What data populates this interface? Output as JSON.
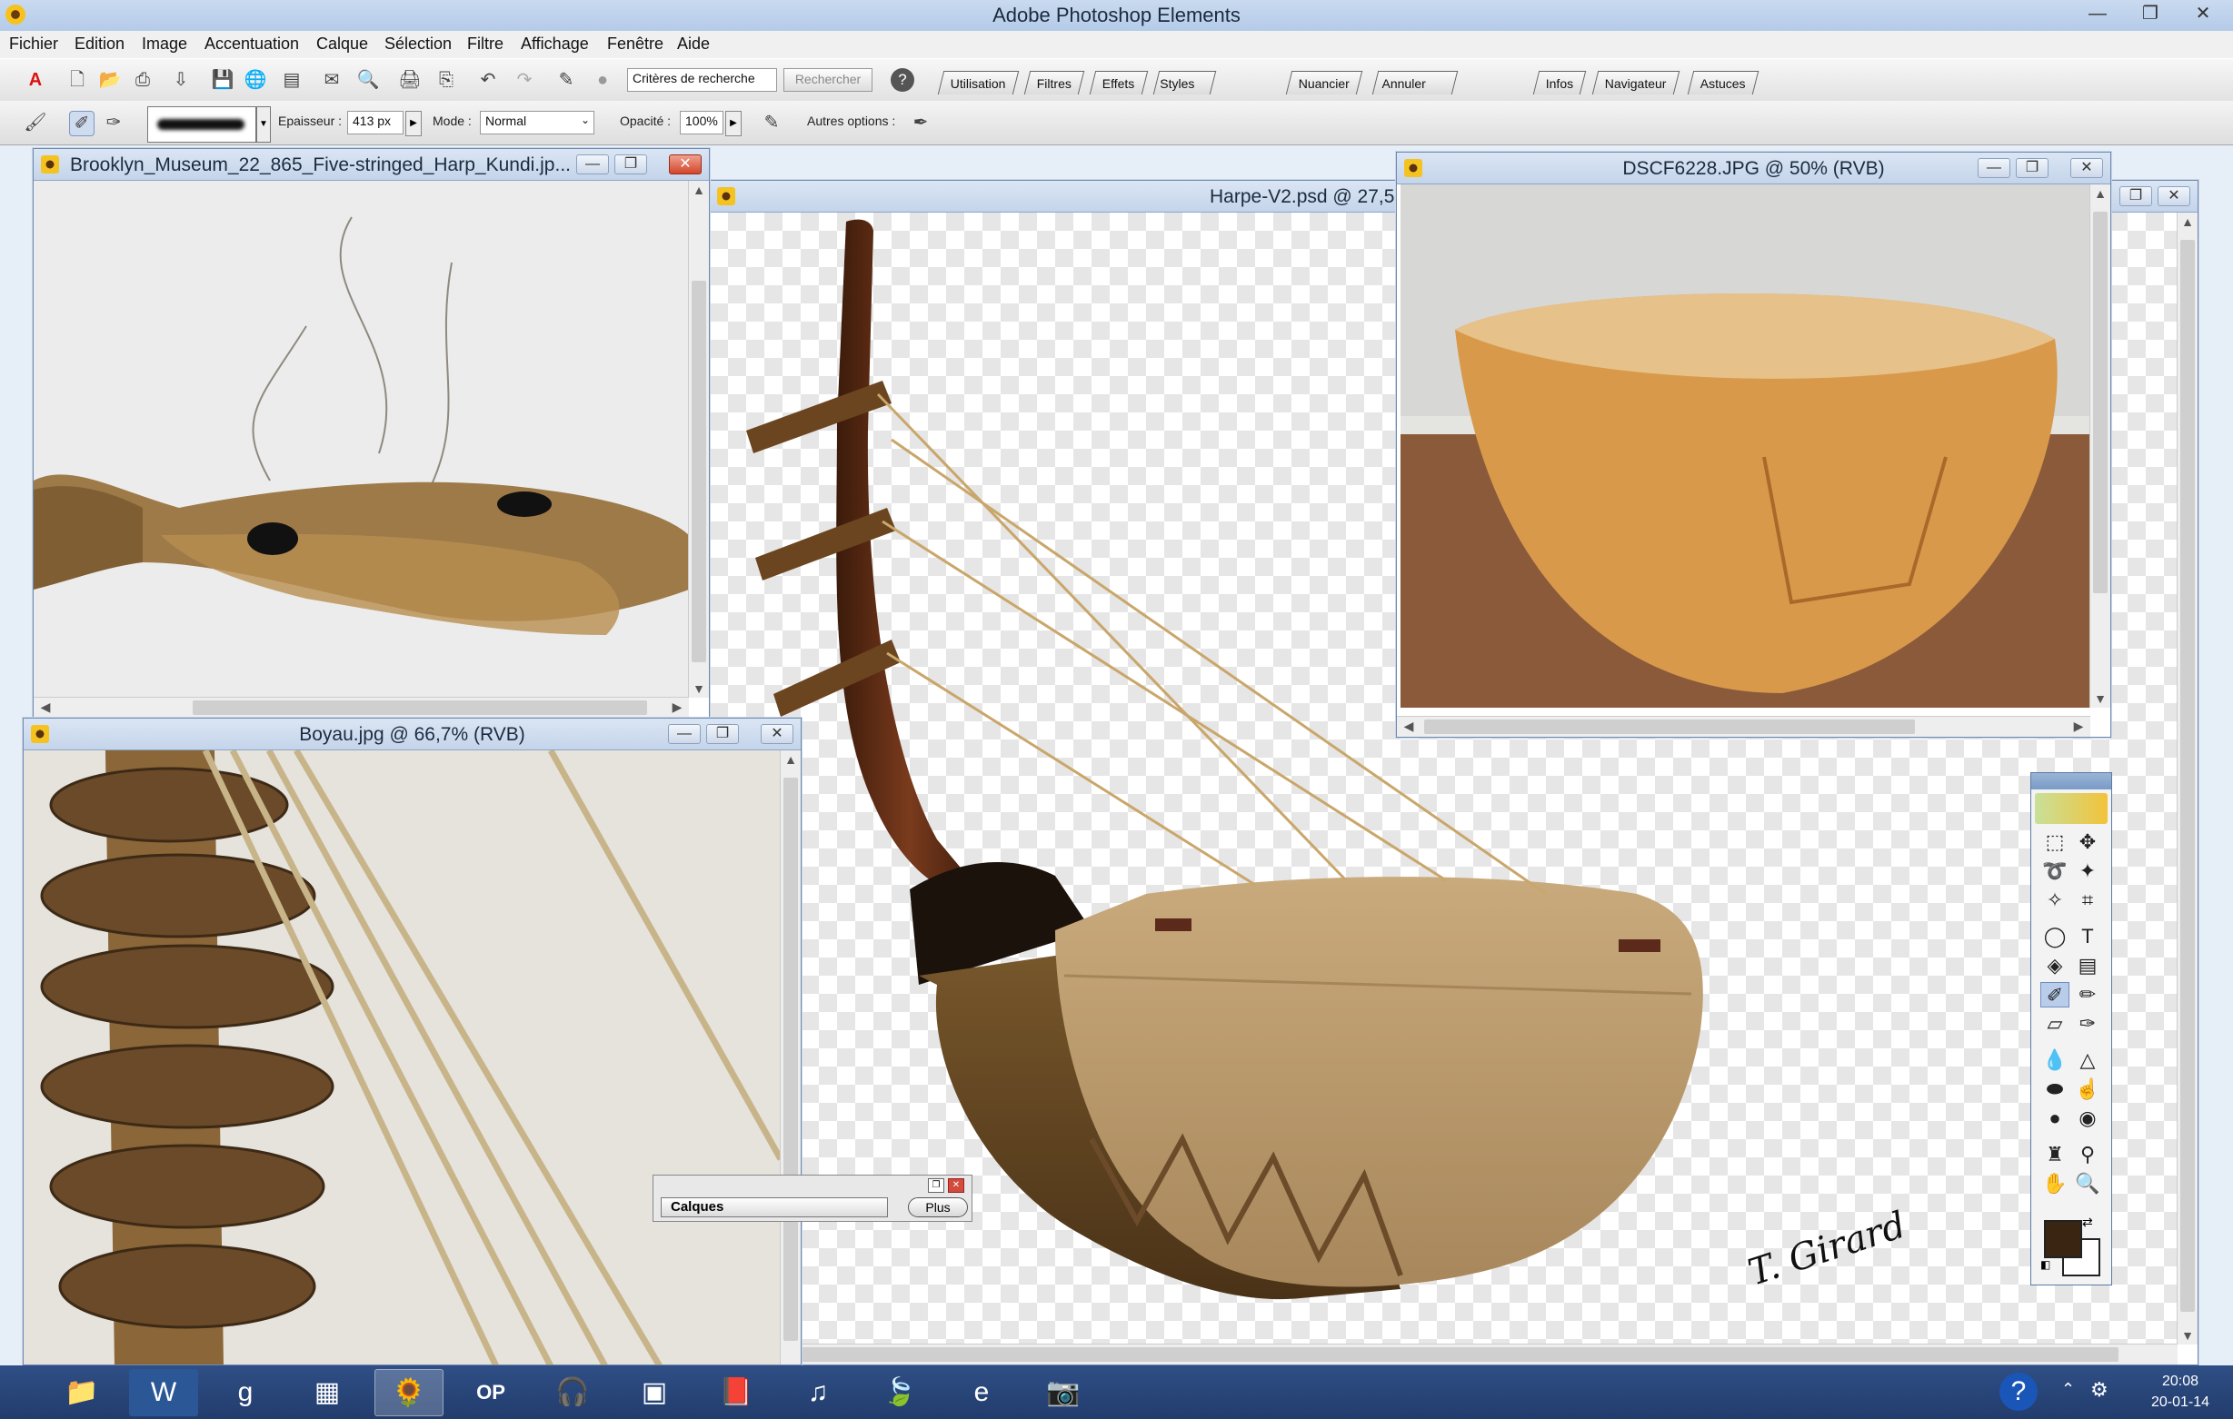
{
  "app": {
    "title": "Adobe Photoshop Elements",
    "icon": "sunflower-icon"
  },
  "menu": [
    "Fichier",
    "Edition",
    "Image",
    "Accentuation",
    "Calque",
    "Sélection",
    "Filtre",
    "Affichage",
    "Fenêtre",
    "Aide"
  ],
  "toolbar": {
    "search_value": "Critères de recherche",
    "search_button": "Rechercher",
    "palette_tabs": [
      "Utilisation",
      "Filtres",
      "Effets",
      "Styles de calque",
      "Nuancier",
      "Annuler l'historique",
      "Infos",
      "Navigateur",
      "Astuces"
    ]
  },
  "options": {
    "epaisseur_label": "Epaisseur :",
    "epaisseur_value": "413 px",
    "mode_label": "Mode :",
    "mode_value": "Normal",
    "opacite_label": "Opacité :",
    "opacite_value": "100%",
    "autres_label": "Autres options :"
  },
  "documents": {
    "brooklyn": "Brooklyn_Museum_22_865_Five-stringed_Harp_Kundi.jp...",
    "boyau": "Boyau.jpg @ 66,7% (RVB)",
    "harpe": "Harpe-V2.psd @ 27,5",
    "dscf": "DSCF6228.JPG @ 50% (RVB)"
  },
  "signature": "T. Girard",
  "calques": {
    "tab": "Calques",
    "more": "Plus"
  },
  "taskbar": {
    "items": [
      "file-explorer-icon",
      "word-icon",
      "google-icon",
      "calculator-icon",
      "photoshop-elements-icon",
      "op-icon",
      "audio-icon",
      "media-icon",
      "reader-icon",
      "itunes-icon",
      "leaf-icon",
      "ie-icon",
      "camera-icon"
    ],
    "time": "20:08",
    "date": "20-01-14"
  },
  "colors": {
    "foreground": "#3a2412",
    "background": "#ffffff",
    "accent": "#2f4f86"
  }
}
